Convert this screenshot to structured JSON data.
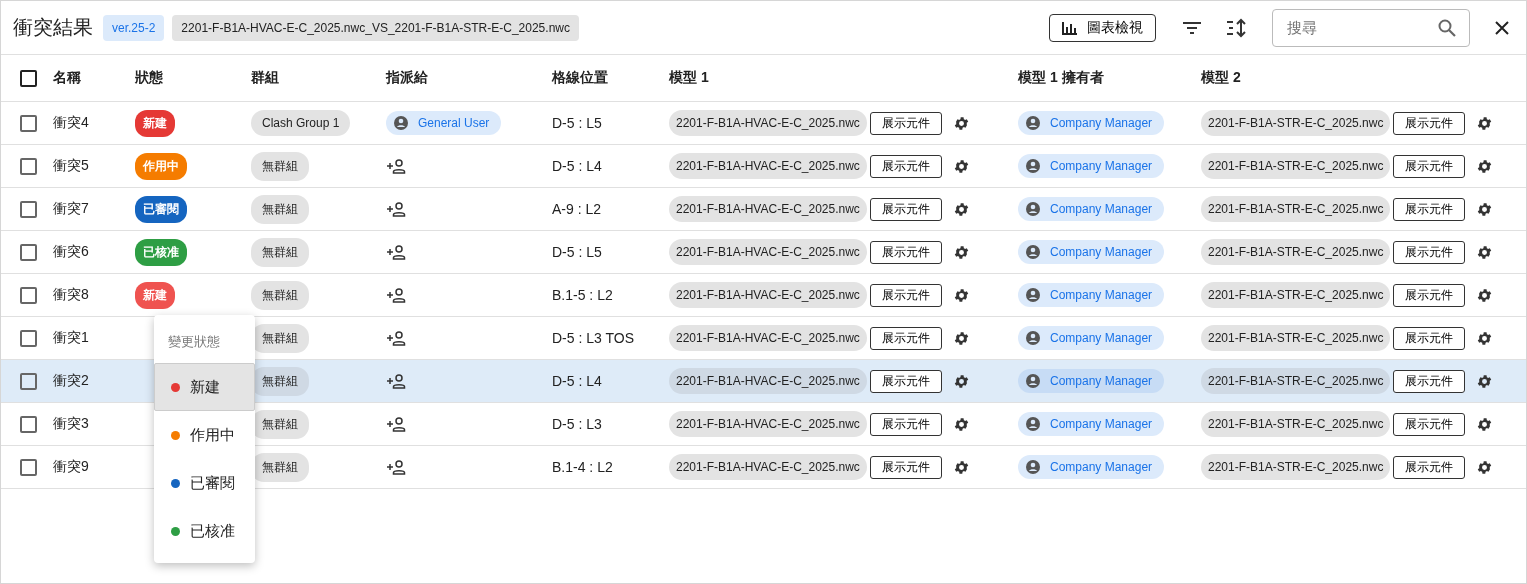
{
  "header": {
    "title": "衝突結果",
    "version": "ver.25-2",
    "file_pair": "2201-F-B1A-HVAC-E-C_2025.nwc_VS_2201-F-B1A-STR-E-C_2025.nwc",
    "chart_button": "圖表檢視",
    "search": {
      "placeholder": "搜尋"
    }
  },
  "table": {
    "columns": [
      "名稱",
      "狀態",
      "群組",
      "指派給",
      "格線位置",
      "模型 1",
      "模型 1 擁有者",
      "模型 2"
    ],
    "select_all": {
      "checked": false
    },
    "rows": [
      {
        "name": "衝突4",
        "status": {
          "label": "新建",
          "color": "#e53935"
        },
        "group": "Clash Group 1",
        "assignee": "General User",
        "grid": "D-5 : L5",
        "model1": "2201-F-B1A-HVAC-E-C_2025.nwc",
        "model1_button": "展示元件",
        "owner": "Company Manager",
        "model2": "2201-F-B1A-STR-E-C_2025.nwc",
        "model2_button": "展示元件",
        "checked": false,
        "selected": false
      },
      {
        "name": "衝突5",
        "status": {
          "label": "作用中",
          "color": "#f57c00"
        },
        "group": "無群組",
        "grid": "D-5 : L4",
        "model1": "2201-F-B1A-HVAC-E-C_2025.nwc",
        "model1_button": "展示元件",
        "owner": "Company Manager",
        "model2": "2201-F-B1A-STR-E-C_2025.nwc",
        "model2_button": "展示元件",
        "checked": false,
        "selected": false
      },
      {
        "name": "衝突7",
        "status": {
          "label": "已審閱",
          "color": "#1565c0"
        },
        "group": "無群組",
        "grid": "A-9 : L2",
        "model1": "2201-F-B1A-HVAC-E-C_2025.nwc",
        "model1_button": "展示元件",
        "owner": "Company Manager",
        "model2": "2201-F-B1A-STR-E-C_2025.nwc",
        "model2_button": "展示元件",
        "checked": false,
        "selected": false
      },
      {
        "name": "衝突6",
        "status": {
          "label": "已核准",
          "color": "#2e9e44"
        },
        "group": "無群組",
        "grid": "D-5 : L5",
        "model1": "2201-F-B1A-HVAC-E-C_2025.nwc",
        "model1_button": "展示元件",
        "owner": "Company Manager",
        "model2": "2201-F-B1A-STR-E-C_2025.nwc",
        "model2_button": "展示元件",
        "checked": false,
        "selected": false
      },
      {
        "name": "衝突8",
        "status": {
          "label": "新建",
          "color": "#ef5350"
        },
        "group": "無群組",
        "grid": "B.1-5 : L2",
        "model1": "2201-F-B1A-HVAC-E-C_2025.nwc",
        "model1_button": "展示元件",
        "owner": "Company Manager",
        "model2": "2201-F-B1A-STR-E-C_2025.nwc",
        "model2_button": "展示元件",
        "checked": false,
        "selected": false
      },
      {
        "name": "衝突1",
        "group": "無群組",
        "grid": "D-5 : L3 TOS",
        "model1": "2201-F-B1A-HVAC-E-C_2025.nwc",
        "model1_button": "展示元件",
        "owner": "Company Manager",
        "model2": "2201-F-B1A-STR-E-C_2025.nwc",
        "model2_button": "展示元件",
        "checked": false,
        "selected": false
      },
      {
        "name": "衝突2",
        "group": "無群組",
        "grid": "D-5 : L4",
        "model1": "2201-F-B1A-HVAC-E-C_2025.nwc",
        "model1_button": "展示元件",
        "owner": "Company Manager",
        "model2": "2201-F-B1A-STR-E-C_2025.nwc",
        "model2_button": "展示元件",
        "checked": false,
        "selected": true
      },
      {
        "name": "衝突3",
        "group": "無群組",
        "grid": "D-5 : L3",
        "model1": "2201-F-B1A-HVAC-E-C_2025.nwc",
        "model1_button": "展示元件",
        "owner": "Company Manager",
        "model2": "2201-F-B1A-STR-E-C_2025.nwc",
        "model2_button": "展示元件",
        "checked": false,
        "selected": false
      },
      {
        "name": "衝突9",
        "group": "無群組",
        "grid": "B.1-4 : L2",
        "model1": "2201-F-B1A-HVAC-E-C_2025.nwc",
        "model1_button": "展示元件",
        "owner": "Company Manager",
        "model2": "2201-F-B1A-STR-E-C_2025.nwc",
        "model2_button": "展示元件",
        "checked": false,
        "selected": false
      }
    ]
  },
  "status_menu": {
    "title": "變更狀態",
    "items": [
      {
        "label": "新建",
        "color": "#e53935",
        "selected": true
      },
      {
        "label": "作用中",
        "color": "#f57c00",
        "selected": false
      },
      {
        "label": "已審閱",
        "color": "#1565c0",
        "selected": false
      },
      {
        "label": "已核准",
        "color": "#2e9e44",
        "selected": false
      }
    ]
  }
}
